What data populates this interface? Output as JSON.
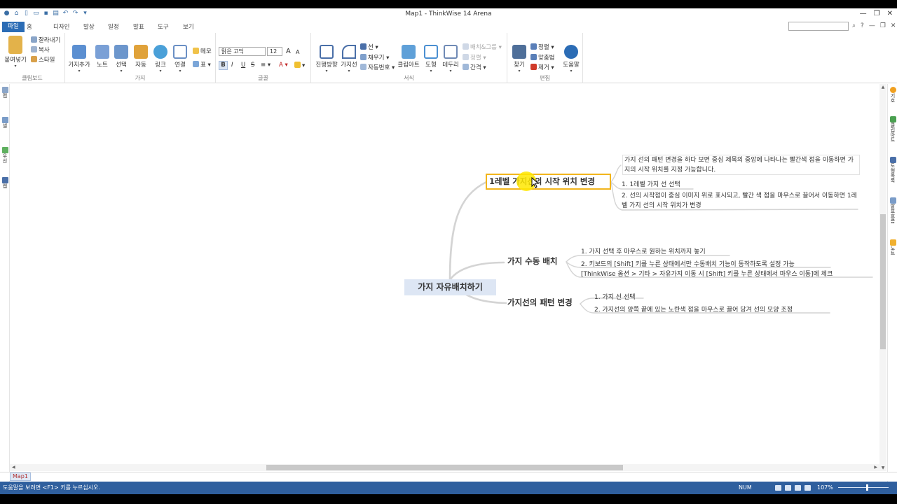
{
  "window": {
    "title": "Map1 - ThinkWise 14 Arena",
    "controls": [
      "▾",
      "?",
      "—",
      "❐",
      "✕"
    ]
  },
  "menu": {
    "tabs": [
      "파일",
      "홈",
      "디자인",
      "발상",
      "일정",
      "발표",
      "도구",
      "보기"
    ]
  },
  "ribbon": {
    "clipboard": {
      "label": "클립보드",
      "paste": "붙여넣기",
      "cut": "잘라내기",
      "copy": "복사",
      "style": "스타일"
    },
    "branch": {
      "label": "가지",
      "add": "가지추가",
      "note": "노트",
      "select": "선택",
      "auto": "자동",
      "link": "링크",
      "connect": "연결",
      "memo": "메모",
      "table": "표"
    },
    "font": {
      "label": "글꼴",
      "family": "맑은 고딕",
      "size": "12",
      "bold": "B",
      "italic": "I",
      "underline": "U",
      "strike": "S"
    },
    "format": {
      "label": "서식",
      "direction": "진행방향",
      "branchline": "가지선",
      "line": "선",
      "fill": "채우기",
      "autonum": "자동번호",
      "clipart": "클립아트",
      "shape": "도형",
      "border": "테두리",
      "arrange": "배치&그룹",
      "align": "정렬",
      "spacing": "간격"
    },
    "edit": {
      "label": "편집",
      "find": "찾기",
      "sort": "정렬",
      "spell": "맞춤법",
      "remove": "제거",
      "help": "도움말"
    }
  },
  "left_panel": [
    "맵",
    "셀",
    "우선",
    "웹"
  ],
  "right_panel": [
    "기호",
    "클립아트",
    "도형목록",
    "발표흐름",
    "노트"
  ],
  "map": {
    "central": "가지 자유배치하기",
    "branches": [
      {
        "label": "1레벨 가지선의 시작 위치 변경",
        "description": "가지 선의 패턴 변경을 하다 보면 중심 제목의 중앙에 나타나는 빨간색 점을 이동하면 가지의 시작 위치를 지정 가능합니다.",
        "items": [
          "1. 1레벨 가지 선 선택",
          "2. 선의 시작점이 중심 이미지 위로 표시되고, 빨간 색 점을 마우스로 끌어서 이동하면 1레벨 가지 선의 시작 위치가 변경"
        ]
      },
      {
        "label": "가지 수동 배치",
        "items": [
          "1. 가지 선택 후 마우스로 원하는 위치까지 놓기",
          "2. 키보드의 [Shift] 키를 누른 상태에서만 수동배치 기능이 동작하도록 설정 가능",
          "[ThinkWise 옵션 > 기타 > 자유가지 이동 시 [Shift] 키를 누른 상태에서 마우스 이동]에 체크"
        ]
      },
      {
        "label": "가지선의 패턴 변경",
        "items": [
          "1. 가지 선 선택",
          "2. 가지선의 양쪽 끝에 있는 노란색 점을 마우스로 끌어 당겨 선의 모양 조정"
        ]
      }
    ]
  },
  "tabs": {
    "map_tab": "Map1"
  },
  "status": {
    "message": "도움말을 보려면 <F1> 키를 누르십시오.",
    "num": "NUM",
    "zoom": "107%"
  },
  "colors": {
    "accent": "#2b6cb5",
    "statusbar": "#2f5f9e",
    "selection": "#f2b51c",
    "central_fill": "#dde6f4",
    "branch_line": "#d4d4d4"
  }
}
